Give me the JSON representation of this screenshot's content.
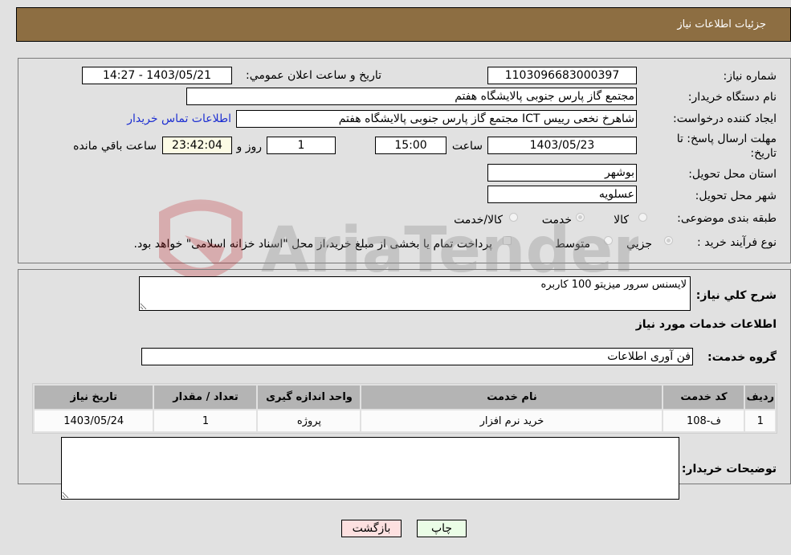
{
  "header": {
    "title": "جزئیات اطلاعات نیاز"
  },
  "form": {
    "need_number_label": "شماره نیاز:",
    "need_number": "1103096683000397",
    "announce_label": "تاریخ و ساعت اعلان عمومي:",
    "announce_value": "1403/05/21 - 14:27",
    "buyer_org_label": "نام دستگاه خریدار:",
    "buyer_org": "مجتمع گاز پارس جنوبی  پالایشگاه هفتم",
    "creator_label": "ایجاد کننده درخواست:",
    "creator": "شاهرخ نخعی رییس ICT مجتمع گاز پارس جنوبی  پالایشگاه هفتم",
    "contact_link": "اطلاعات تماس خریدار",
    "deadline_label_line1": "مهلت ارسال پاسخ: تا",
    "deadline_label_line2": "تاریخ:",
    "deadline_date": "1403/05/23",
    "time_label": "ساعت",
    "deadline_time": "15:00",
    "days_value": "1",
    "days_label": "روز و",
    "remaining_value": "23:42:04",
    "remaining_label": "ساعت باقي مانده",
    "province_label": "استان محل تحویل:",
    "province": "بوشهر",
    "city_label": "شهر محل تحویل:",
    "city": "عسلویه",
    "category_label": "طبقه بندی موضوعی:",
    "category_options": [
      "کالا",
      "خدمت",
      "کالا/خدمت"
    ],
    "category_selected": "خدمت",
    "process_label": "نوع فرآیند خرید :",
    "process_options": [
      "جزيي",
      "متوسط"
    ],
    "process_selected": "جزيي",
    "treasury_note": "پرداخت تمام یا بخشی از مبلغ خرید،از محل \"اسناد خزانه اسلامی\" خواهد بود."
  },
  "details": {
    "summary_label": "شرح كلي نياز:",
    "summary_value": "لایسنس سرور میزیتو 100 کاربره",
    "services_heading": "اطلاعات خدمات مورد نياز",
    "service_group_label": "گروه خدمت:",
    "service_group_value": "فن آوری اطلاعات",
    "table": {
      "headers": [
        "رديف",
        "کد خدمت",
        "نام خدمت",
        "واحد اندازه گیری",
        "تعداد / مقدار",
        "تاریخ نیاز"
      ],
      "rows": [
        [
          "1",
          "ف-108",
          "خرید نرم افزار",
          "پروژه",
          "1",
          "1403/05/24"
        ]
      ]
    },
    "buyer_notes_label": "توضیحات خریدار:",
    "buyer_notes_value": ""
  },
  "buttons": {
    "print": "چاپ",
    "back": "بازگشت"
  },
  "colors": {
    "header_bg": "#8d6e42",
    "print_bg": "#eafde6",
    "back_bg": "#fde0e0",
    "link": "#1d2fd1"
  },
  "watermark": {
    "text": "AriaTender.neT"
  }
}
